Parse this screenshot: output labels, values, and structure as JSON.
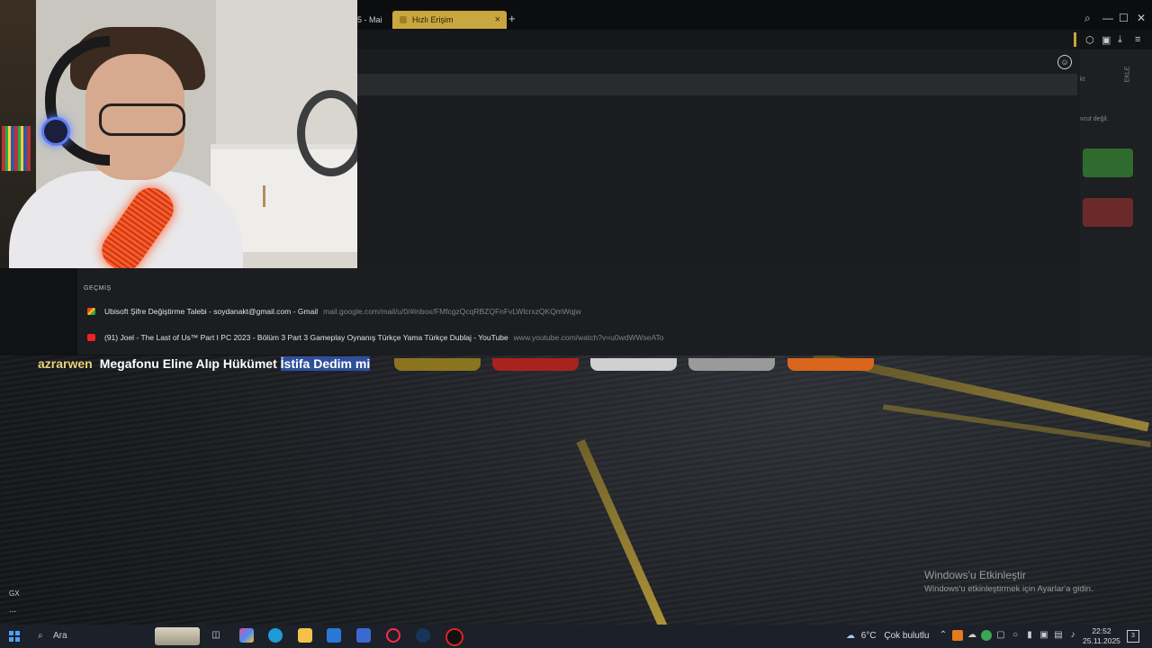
{
  "browser": {
    "tabs": [
      {
        "title": "5 - Mai"
      },
      {
        "title": "Hızlı Erişim",
        "active": true
      }
    ],
    "new_tab_label": "+",
    "close_tab_label": "×",
    "window_controls": {
      "minimize": "—",
      "maximize": "☐",
      "close": "✕"
    },
    "accent_color": "#c8a640"
  },
  "dropdown": {
    "history_heading": "GEÇMİŞ",
    "items": [
      {
        "title": "Ubisoft Şifre Değiştirme Talebi - soydanakt@gmail.com - Gmail",
        "url": "mail.google.com/mail/u/0/#inbox/FMfcgzQcqRBZQFnFvLWlcrxzQKQmWqjw",
        "icon": "gmail-icon"
      },
      {
        "title": "(91) Joel - The Last of Us™ Part I PC 2023 - Bölüm 3 Part 3 Gameplay Oynanış Türkçe Yama Türkçe Dublaj - YouTube",
        "url": "www.youtube.com/watch?v=u0wdWWseATo",
        "icon": "youtube-icon"
      }
    ]
  },
  "right_strip": {
    "text1": "kt",
    "text2": "EKLE",
    "text3": "vcut değil."
  },
  "chat": {
    "username": "azrarwen",
    "message_plain": "Megafonu Eline Alıp Hükümet ",
    "message_selected": "İstifa Dedim mi"
  },
  "desktop": {
    "activation_title": "Windows'u Etkinleştir",
    "activation_sub": "Windows'u etkinleştirmek için Ayarlar'a gidin.",
    "gx_label": "GX",
    "more_label": "..."
  },
  "taskbar": {
    "search_placeholder": "Ara",
    "weather_temp": "6°C",
    "weather_desc": "Çok bulutlu",
    "time": "22:52",
    "date": "25.11.2025",
    "notification_count": "3"
  }
}
